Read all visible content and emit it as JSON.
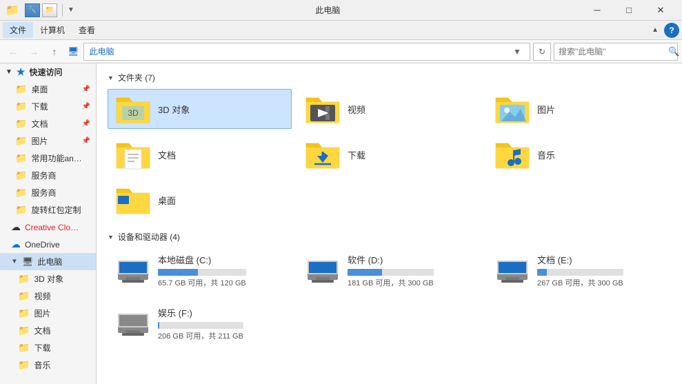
{
  "titlebar": {
    "title": "此电脑",
    "min_label": "─",
    "max_label": "□",
    "close_label": "✕"
  },
  "menubar": {
    "items": [
      "文件",
      "计算机",
      "查看"
    ]
  },
  "addressbar": {
    "path_home": "此电脑",
    "search_placeholder": "搜索\"此电脑\""
  },
  "sidebar": {
    "quick_access_label": "快速访问",
    "items": [
      {
        "id": "desktop",
        "label": "桌面",
        "pinned": true
      },
      {
        "id": "downloads",
        "label": "下载",
        "pinned": true
      },
      {
        "id": "documents",
        "label": "文档",
        "pinned": true
      },
      {
        "id": "pictures",
        "label": "图片",
        "pinned": true
      },
      {
        "id": "common",
        "label": "常用功能and弹窗"
      },
      {
        "id": "service1",
        "label": "服务商"
      },
      {
        "id": "service2",
        "label": "服务商"
      },
      {
        "id": "redirect",
        "label": "旋转红包定制"
      },
      {
        "id": "creative",
        "label": "Creative Cloud F"
      },
      {
        "id": "onedrive",
        "label": "OneDrive"
      },
      {
        "id": "thispc",
        "label": "此电脑",
        "active": true
      },
      {
        "id": "3dobjects",
        "label": "3D 对象"
      },
      {
        "id": "videos",
        "label": "视频"
      },
      {
        "id": "pics",
        "label": "图片"
      },
      {
        "id": "docs",
        "label": "文档"
      },
      {
        "id": "dl",
        "label": "下载"
      },
      {
        "id": "music",
        "label": "音乐"
      }
    ]
  },
  "content": {
    "folders_section_label": "文件夹 (7)",
    "drives_section_label": "设备和驱动器 (4)",
    "folders": [
      {
        "id": "3d",
        "name": "3D 对象",
        "type": "3d",
        "selected": true
      },
      {
        "id": "video",
        "name": "视频",
        "type": "video"
      },
      {
        "id": "pictures",
        "name": "图片",
        "type": "pictures"
      },
      {
        "id": "documents",
        "name": "文档",
        "type": "documents"
      },
      {
        "id": "downloads",
        "name": "下载",
        "type": "downloads"
      },
      {
        "id": "music",
        "name": "音乐",
        "type": "music"
      },
      {
        "id": "desktop",
        "name": "桌面",
        "type": "desktop"
      }
    ],
    "drives": [
      {
        "id": "c",
        "name": "本地磁盘 (C:)",
        "free": "65.7 GB 可用，共 120 GB",
        "percent": 45
      },
      {
        "id": "d",
        "name": "软件 (D:)",
        "free": "181 GB 可用，共 300 GB",
        "percent": 40
      },
      {
        "id": "e",
        "name": "文档 (E:)",
        "free": "267 GB 可用，共 300 GB",
        "percent": 11
      },
      {
        "id": "f",
        "name": "娱乐 (F:)",
        "free": "206 GB 可用，共 211 GB",
        "percent": 2
      }
    ]
  }
}
